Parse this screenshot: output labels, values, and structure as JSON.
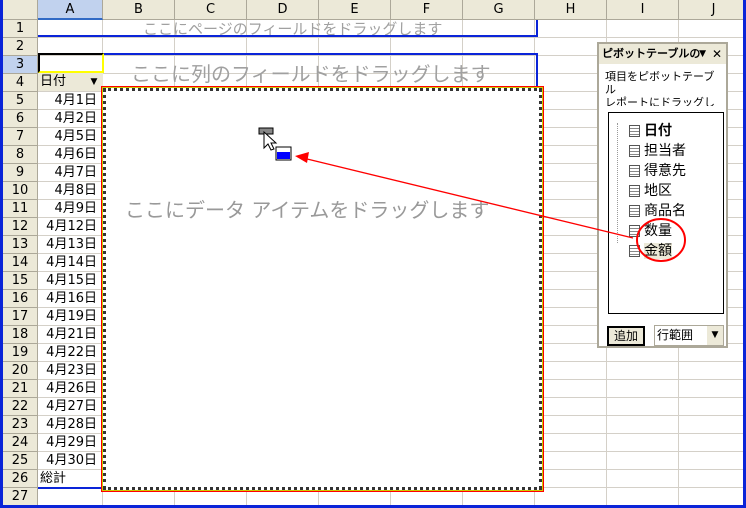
{
  "columns": [
    "A",
    "B",
    "C",
    "D",
    "E",
    "F",
    "G",
    "H",
    "I",
    "J"
  ],
  "rows": [
    "1",
    "2",
    "3",
    "4",
    "5",
    "6",
    "7",
    "8",
    "9",
    "10",
    "11",
    "12",
    "13",
    "14",
    "15",
    "16",
    "17",
    "18",
    "19",
    "20",
    "21",
    "22",
    "23",
    "24",
    "25",
    "26",
    "27"
  ],
  "page_drop_text": "ここにページのフィールドをドラッグします",
  "column_drop_text": "ここに列のフィールドをドラッグします",
  "data_drop_text": "ここにデータ アイテムをドラッグします",
  "row_field": "日付",
  "dates": [
    "4月1日",
    "4月2日",
    "4月5日",
    "4月6日",
    "4月7日",
    "4月8日",
    "4月9日",
    "4月12日",
    "4月13日",
    "4月14日",
    "4月15日",
    "4月16日",
    "4月19日",
    "4月21日",
    "4月22日",
    "4月23日",
    "4月26日",
    "4月27日",
    "4月28日",
    "4月29日",
    "4月30日"
  ],
  "grand_total": "総計",
  "panel": {
    "title": "ピボットテーブルの",
    "desc1": "項目をピボットテーブル",
    "desc2": "レポートにドラッグします",
    "fields": [
      "日付",
      "担当者",
      "得意先",
      "地区",
      "商品名",
      "数量",
      "金額"
    ],
    "add_label": "追加",
    "area_select": "行範囲"
  },
  "colors": {
    "annotation": "#ff0000",
    "pivot_border": "#0a24d8"
  }
}
